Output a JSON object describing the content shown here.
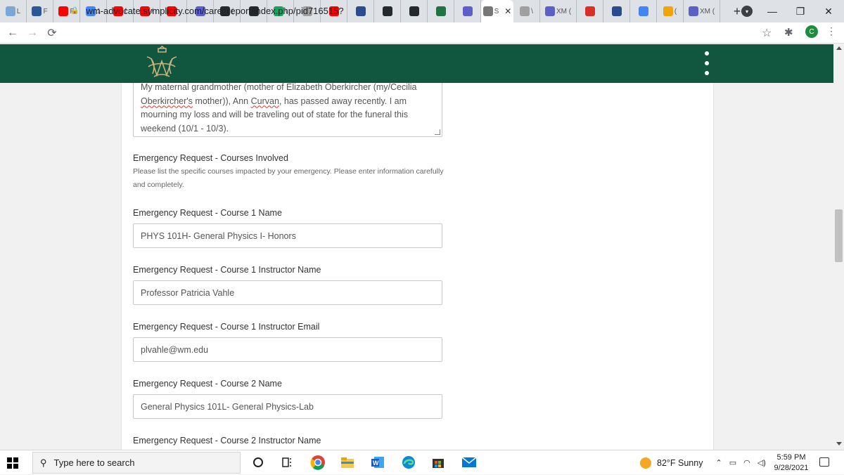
{
  "browser": {
    "tabs": [
      {
        "icon": "tab-favicon",
        "label": "L",
        "color": "#7aa7d8"
      },
      {
        "icon": "tab-favicon",
        "label": "F",
        "color": "#2b579a"
      },
      {
        "icon": "youtube-icon",
        "label": "F",
        "color": "#ff0000"
      },
      {
        "icon": "google-icon",
        "label": "1",
        "color": "#4285f4"
      },
      {
        "icon": "youtube-icon",
        "label": "f",
        "color": "#ff0000"
      },
      {
        "icon": "youtube-icon",
        "label": "/",
        "color": "#ff0000"
      },
      {
        "icon": "youtube-icon",
        "label": "·",
        "color": "#ff0000"
      },
      {
        "icon": "s-icon",
        "label": "",
        "color": "#5b5fc7"
      },
      {
        "icon": "github-icon",
        "label": "(",
        "color": "#24292e"
      },
      {
        "icon": "github-icon",
        "label": "",
        "color": "#24292e"
      },
      {
        "icon": "check-icon",
        "label": "\\",
        "color": "#1aa260"
      },
      {
        "icon": "seal-icon",
        "label": "",
        "color": "#a0a0a0"
      },
      {
        "icon": "youtube-icon",
        "label": "",
        "color": "#ff0000"
      },
      {
        "icon": "b-icon",
        "label": "",
        "color": "#2a4b8d"
      },
      {
        "icon": "github-icon",
        "label": "",
        "color": "#24292e"
      },
      {
        "icon": "github-icon",
        "label": "",
        "color": "#24292e"
      },
      {
        "icon": "excel-icon",
        "label": "",
        "color": "#217346"
      },
      {
        "icon": "w-icon",
        "label": "",
        "color": "#5b5fc7"
      },
      {
        "icon": "s-tab-icon",
        "label": "S",
        "color": "#777777",
        "active": true
      },
      {
        "icon": "seal-icon",
        "label": "\\",
        "color": "#a0a0a0"
      },
      {
        "icon": "xm-icon",
        "label": "XM (",
        "color": "#5b5fc7"
      },
      {
        "icon": "gmail-icon",
        "label": "",
        "color": "#d93025"
      },
      {
        "icon": "b-icon",
        "label": "",
        "color": "#2a4b8d"
      },
      {
        "icon": "google-icon",
        "label": "",
        "color": "#4285f4"
      },
      {
        "icon": "note-icon",
        "label": "(",
        "color": "#f0a30a"
      },
      {
        "icon": "xm-icon",
        "label": "XM (",
        "color": "#5b5fc7"
      }
    ],
    "url": "wm-advocate.symplicity.com/care_report/index.php/pid716515?",
    "profile_initial": "C"
  },
  "form": {
    "textarea_line1": "My maternal grandmother (mother of Elizabeth Oberkircher (my/Cecilia",
    "textarea_line2_a": "Oberkircher's",
    "textarea_line2_b": " mother)), Ann ",
    "textarea_line2_c": "Curvan",
    "textarea_line2_d": ", has passed away recently. I am",
    "textarea_line3": "mourning my loss and will be traveling out of state for the funeral this",
    "textarea_line4": "weekend (10/1 - 10/3).",
    "section_title": "Emergency Request - Courses Involved",
    "section_help": "Please list the specific courses impacted by your emergency. Please enter information carefully and completely.",
    "fields": [
      {
        "label": "Emergency Request - Course 1 Name",
        "value": "PHYS 101H- General Physics I- Honors"
      },
      {
        "label": "Emergency Request - Course 1 Instructor Name",
        "value": "Professor Patricia Vahle"
      },
      {
        "label": "Emergency Request - Course 1 Instructor Email",
        "value": "plvahle@wm.edu"
      },
      {
        "label": "Emergency Request - Course 2 Name",
        "value": "General Physics 101L- General Physics-Lab"
      },
      {
        "label": "Emergency Request - Course 2 Instructor Name",
        "value": ""
      }
    ]
  },
  "site": {
    "header_color": "#115740"
  },
  "taskbar": {
    "search_placeholder": "Type here to search",
    "weather": "82°F  Sunny",
    "time": "5:59 PM",
    "date": "9/28/2021"
  }
}
